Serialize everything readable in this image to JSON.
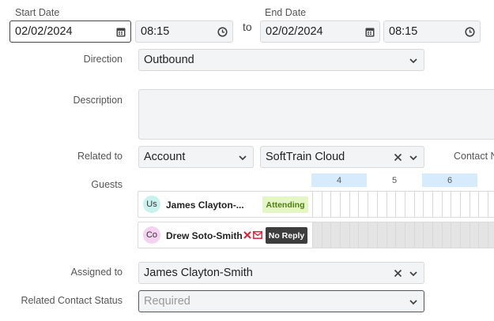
{
  "start_date": {
    "label": "Start Date",
    "date": "02/02/2024",
    "time": "08:15"
  },
  "to_label": "to",
  "end_date": {
    "label": "End Date",
    "date": "02/02/2024",
    "time": "08:15"
  },
  "direction": {
    "label": "Direction",
    "value": "Outbound"
  },
  "description": {
    "label": "Description",
    "value": ""
  },
  "related_to": {
    "label": "Related to",
    "type": "Account",
    "value": "SoftTrain Cloud",
    "contact_label": "Contact N"
  },
  "guests": {
    "label": "Guests",
    "hours": [
      "4",
      "5",
      "6"
    ],
    "list": [
      {
        "initials": "Us",
        "name": "James Clayton-...",
        "status": "Attending",
        "avatar_color": "#c9f2ee"
      },
      {
        "initials": "Co",
        "name": "Drew Soto-Smith",
        "status": "No Reply",
        "avatar_color": "#f6d2f1"
      }
    ]
  },
  "assigned_to": {
    "label": "Assigned to",
    "value": "James Clayton-Smith"
  },
  "related_contact_status": {
    "label": "Related Contact Status",
    "placeholder": "Required"
  },
  "colors": {
    "attending_bg": "#e4f6c4",
    "attending_text": "#4f7d16",
    "noreply_bg": "#3d3d3d",
    "highlight_hour": "#d6ebfb",
    "error_red": "#e0213c"
  }
}
